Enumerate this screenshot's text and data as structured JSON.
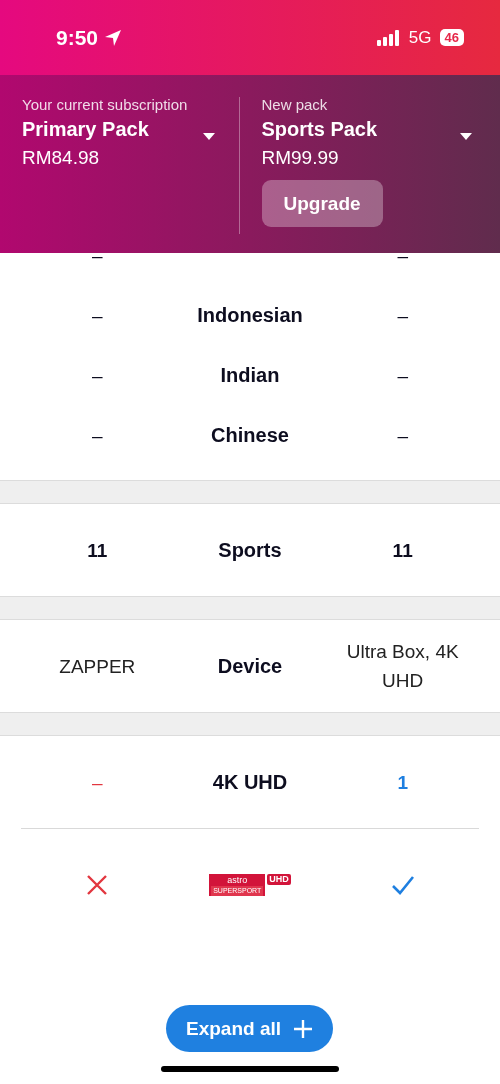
{
  "status_bar": {
    "time": "9:50",
    "network": "5G",
    "battery": "46"
  },
  "header": {
    "current": {
      "caption": "Your current subscription",
      "pack": "Primary Pack",
      "price": "RM84.98"
    },
    "new": {
      "caption": "New pack",
      "pack": "Sports Pack",
      "price": "RM99.99",
      "action": "Upgrade"
    }
  },
  "sections": [
    {
      "rows": [
        {
          "separated": false,
          "left": {
            "kind": "text",
            "text": "–",
            "bold": false,
            "color": "#0d0d1f"
          },
          "right": {
            "kind": "text",
            "text": "–",
            "bold": false,
            "color": "#0d0d1f"
          }
        },
        {
          "separated": false,
          "left": {
            "kind": "text",
            "text": "–",
            "bold": false,
            "color": "#0d0d1f"
          },
          "label": {
            "kind": "text",
            "text": "Indonesian"
          },
          "right": {
            "kind": "text",
            "text": "–",
            "bold": false,
            "color": "#0d0d1f"
          }
        },
        {
          "separated": false,
          "left": {
            "kind": "text",
            "text": "–",
            "bold": false,
            "color": "#0d0d1f"
          },
          "label": {
            "kind": "text",
            "text": "Indian"
          },
          "right": {
            "kind": "text",
            "text": "–",
            "bold": false,
            "color": "#0d0d1f"
          }
        },
        {
          "separated": false,
          "left": {
            "kind": "text",
            "text": "–",
            "bold": false,
            "color": "#0d0d1f"
          },
          "label": {
            "kind": "text",
            "text": "Chinese"
          },
          "right": {
            "kind": "text",
            "text": "–",
            "bold": false,
            "color": "#0d0d1f"
          }
        }
      ]
    },
    {
      "rows": [
        {
          "separated": false,
          "left": {
            "kind": "text",
            "text": "11",
            "bold": true,
            "color": "#0d0d1f"
          },
          "label": {
            "kind": "text",
            "text": "Sports"
          },
          "right": {
            "kind": "text",
            "text": "11",
            "bold": true,
            "color": "#0d0d1f"
          }
        }
      ]
    },
    {
      "rows": [
        {
          "separated": false,
          "left": {
            "kind": "text",
            "text": "ZAPPER",
            "bold": false,
            "color": "#222222"
          },
          "label": {
            "kind": "text",
            "text": "Device"
          },
          "right": {
            "kind": "text",
            "text": "Ultra Box, 4K UHD",
            "bold": false,
            "color": "#222222"
          }
        }
      ]
    },
    {
      "rows": [
        {
          "separated": false,
          "left": {
            "kind": "text",
            "text": "–",
            "bold": false,
            "color": "#e2363f"
          },
          "label": {
            "kind": "text",
            "text": "4K UHD"
          },
          "right": {
            "kind": "text",
            "text": "1",
            "bold": true,
            "color": "#1e7fe0"
          }
        },
        {
          "separated": true,
          "left": {
            "kind": "cross"
          },
          "label": {
            "kind": "logo",
            "brand": "astro",
            "sub": "SUPERSPORT",
            "badge": "UHD"
          },
          "right": {
            "kind": "check"
          }
        }
      ]
    }
  ],
  "expand_button": "Expand all"
}
